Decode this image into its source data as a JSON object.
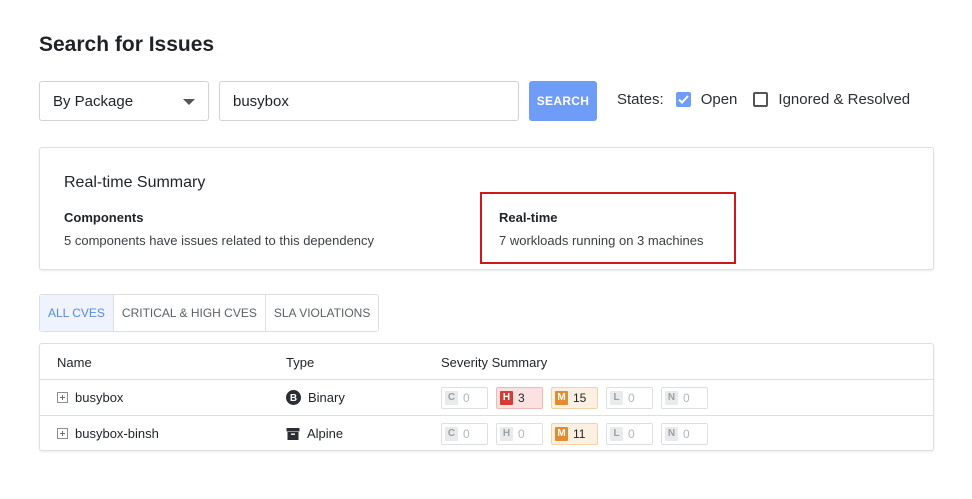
{
  "page": {
    "title": "Search for Issues"
  },
  "search": {
    "mode": "By Package",
    "query": "busybox",
    "button_label": "SEARCH",
    "states_label": "States:",
    "open_label": "Open",
    "open_checked": true,
    "ignored_label": "Ignored & Resolved",
    "ignored_checked": false
  },
  "summary": {
    "title": "Real-time Summary",
    "components_heading": "Components",
    "components_text": "5 components have issues related to this dependency",
    "realtime_heading": "Real-time",
    "realtime_text": "7 workloads running on 3 machines"
  },
  "tabs": [
    {
      "label": "ALL CVES",
      "active": true
    },
    {
      "label": "CRITICAL & HIGH CVES",
      "active": false
    },
    {
      "label": "SLA VIOLATIONS",
      "active": false
    }
  ],
  "table": {
    "headers": {
      "name": "Name",
      "type": "Type",
      "severity": "Severity Summary"
    },
    "rows": [
      {
        "name": "busybox",
        "type": "Binary",
        "type_icon": "binary-b-icon",
        "severity": {
          "c": "0",
          "h": "3",
          "m": "15",
          "l": "0",
          "n": "0"
        }
      },
      {
        "name": "busybox-binsh",
        "type": "Alpine",
        "type_icon": "archive-box-icon",
        "severity": {
          "c": "0",
          "h": "0",
          "m": "11",
          "l": "0",
          "n": "0"
        }
      }
    ],
    "severity_letters": {
      "c": "C",
      "h": "H",
      "m": "M",
      "l": "L",
      "n": "N"
    }
  },
  "colors": {
    "accent": "#6f9cf7",
    "high": "#d33c37",
    "medium": "#e38b30",
    "highlight": "#d0181b"
  }
}
